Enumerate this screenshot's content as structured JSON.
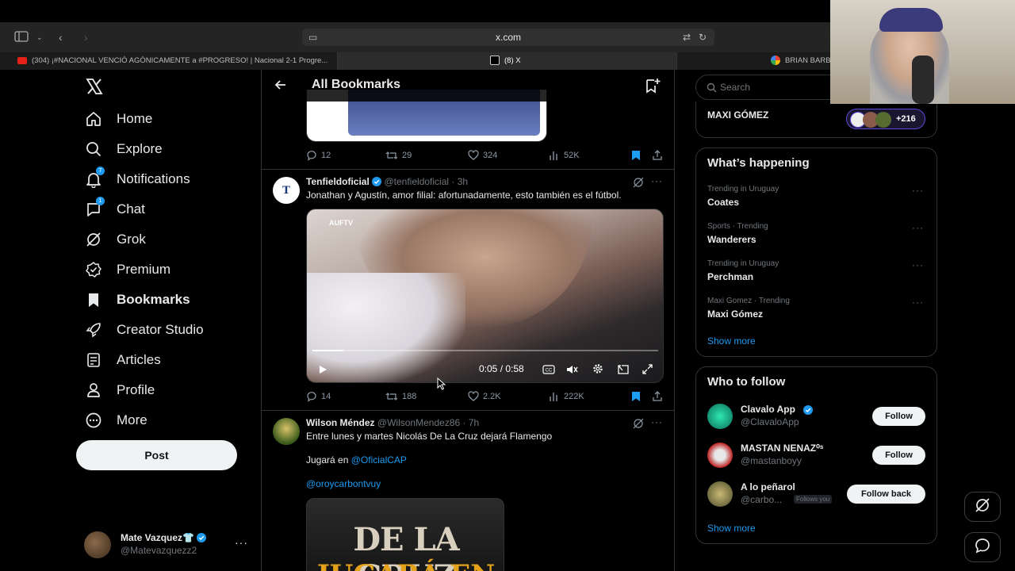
{
  "browser": {
    "url": "x.com",
    "tabs": [
      {
        "label": "(304) ¡#NACIONAL VENCIÓ AGÓNICAMENTE a #PROGRESO! | Nacional 2-1 Progre...",
        "icon": "youtube-icon"
      },
      {
        "label": "(8) X",
        "icon": "x-icon"
      },
      {
        "label": "BRIAN BARB",
        "icon": "google-icon"
      }
    ]
  },
  "nav": {
    "items": [
      {
        "label": "Home",
        "icon": "home-icon"
      },
      {
        "label": "Explore",
        "icon": "search-icon"
      },
      {
        "label": "Notifications",
        "icon": "bell-icon",
        "badge": "7"
      },
      {
        "label": "Chat",
        "icon": "chat-icon",
        "badge": "1"
      },
      {
        "label": "Grok",
        "icon": "grok-icon"
      },
      {
        "label": "Premium",
        "icon": "verified-icon"
      },
      {
        "label": "Bookmarks",
        "icon": "bookmark-icon"
      },
      {
        "label": "Creator Studio",
        "icon": "rocket-icon"
      },
      {
        "label": "Articles",
        "icon": "article-icon"
      },
      {
        "label": "Profile",
        "icon": "person-icon"
      },
      {
        "label": "More",
        "icon": "more-circle-icon"
      }
    ],
    "post_label": "Post",
    "account": {
      "name": "Mate Vazquez👕",
      "handle": "@Matevazquezz2"
    }
  },
  "header": {
    "title": "All Bookmarks"
  },
  "tweets": [
    {
      "actions": {
        "replies": "12",
        "reposts": "29",
        "likes": "324",
        "views": "52K"
      }
    },
    {
      "name": "Tenfieldoficial",
      "handle": "@tenfieldoficial",
      "time": "· 3h",
      "text": "Jonathan y Agustín, amor filial: afortunadamente, esto también es el fútbol.",
      "video": {
        "watermark": "AUFTV",
        "time": "0:05 / 0:58",
        "progress": 0.09
      },
      "actions": {
        "replies": "14",
        "reposts": "188",
        "likes": "2.2K",
        "views": "222K"
      }
    },
    {
      "name": "Wilson Méndez",
      "handle": "@WilsonMendez86",
      "time": "· 7h",
      "lines": [
        "Entre lunes y martes Nicolás De La Cruz dejará Flamengo",
        "Jugará en",
        "@OficialCAP",
        "@oroycarbontvuy"
      ],
      "image_text": [
        "DE LA CRUZ",
        "JUGARÁ EN"
      ]
    }
  ],
  "right": {
    "search_placeholder": "Search",
    "community": {
      "name": "MAXI GÓMEZ",
      "count": "+216"
    },
    "happening": {
      "title": "What’s happening",
      "trends": [
        {
          "meta": "Trending in Uruguay",
          "name": "Coates"
        },
        {
          "meta": "Sports · Trending",
          "name": "Wanderers"
        },
        {
          "meta": "Trending in Uruguay",
          "name": "Perchman"
        },
        {
          "meta": "Maxi Gomez · Trending",
          "name": "Maxi Gómez"
        }
      ],
      "show_more": "Show more"
    },
    "who_to_follow": {
      "title": "Who to follow",
      "accounts": [
        {
          "name": "Clavalo App",
          "handle": "@ClavaloApp",
          "button": "Follow"
        },
        {
          "name": "MASTAN NENAZ⁰ˢ",
          "handle": "@mastanboyy",
          "button": "Follow"
        },
        {
          "name": "A lo peñarol",
          "handle": "@carbo...",
          "follows_you": "Follows you",
          "button": "Follow back"
        }
      ],
      "show_more": "Show more"
    }
  },
  "colors": {
    "accent": "#1d9bf0",
    "background": "#000000",
    "border": "#2f3336",
    "muted": "#71767b"
  }
}
